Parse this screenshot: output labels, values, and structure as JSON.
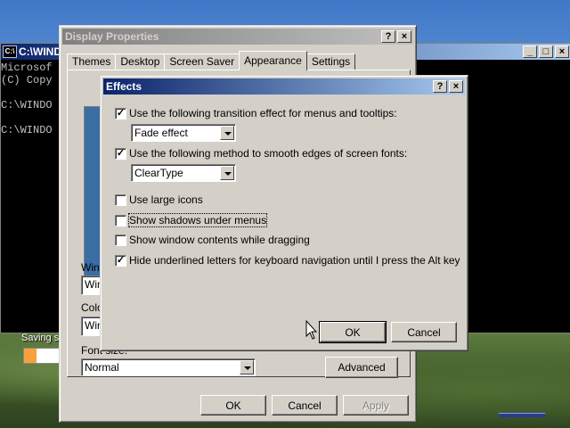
{
  "desktop": {
    "label": "Saving s",
    "progress_fraction": 0.35,
    "colors": {
      "progress": "#f7a13a"
    }
  },
  "console": {
    "title": "C:\\WINDO",
    "icon": "C:\\",
    "lines": [
      "Microsof",
      "(C) Copy",
      "C:\\WINDO",
      "C:\\WINDO"
    ],
    "buttons": [
      "_",
      "□",
      "×"
    ]
  },
  "display_properties": {
    "title": "Display Properties",
    "help_btn": "?",
    "close_btn": "×",
    "tabs": [
      "Themes",
      "Desktop",
      "Screen Saver",
      "Appearance",
      "Settings"
    ],
    "selected_tab": "Appearance",
    "labels": {
      "windows": "Wind",
      "color": "Colo",
      "font_size": "Font size:"
    },
    "combos": {
      "windows": "Win",
      "color": "Win",
      "font_size": "Normal"
    },
    "advanced_btn": "Advanced",
    "ok_btn": "OK",
    "cancel_btn": "Cancel",
    "apply_btn": "Apply"
  },
  "effects": {
    "title": "Effects",
    "help_btn": "?",
    "close_btn": "×",
    "options": [
      {
        "label": "Use the following transition effect for menus and tooltips:",
        "checked": true
      },
      {
        "label": "Use the following method to smooth edges of screen fonts:",
        "checked": true
      },
      {
        "label": "Use large icons",
        "checked": false
      },
      {
        "label": "Show shadows under menus",
        "checked": false
      },
      {
        "label": "Show window contents while dragging",
        "checked": false
      },
      {
        "label": "Hide underlined letters for keyboard navigation until I press the Alt key",
        "checked": true
      }
    ],
    "transition_combo": "Fade effect",
    "smoothing_combo": "ClearType",
    "ok_btn": "OK",
    "cancel_btn": "Cancel"
  }
}
